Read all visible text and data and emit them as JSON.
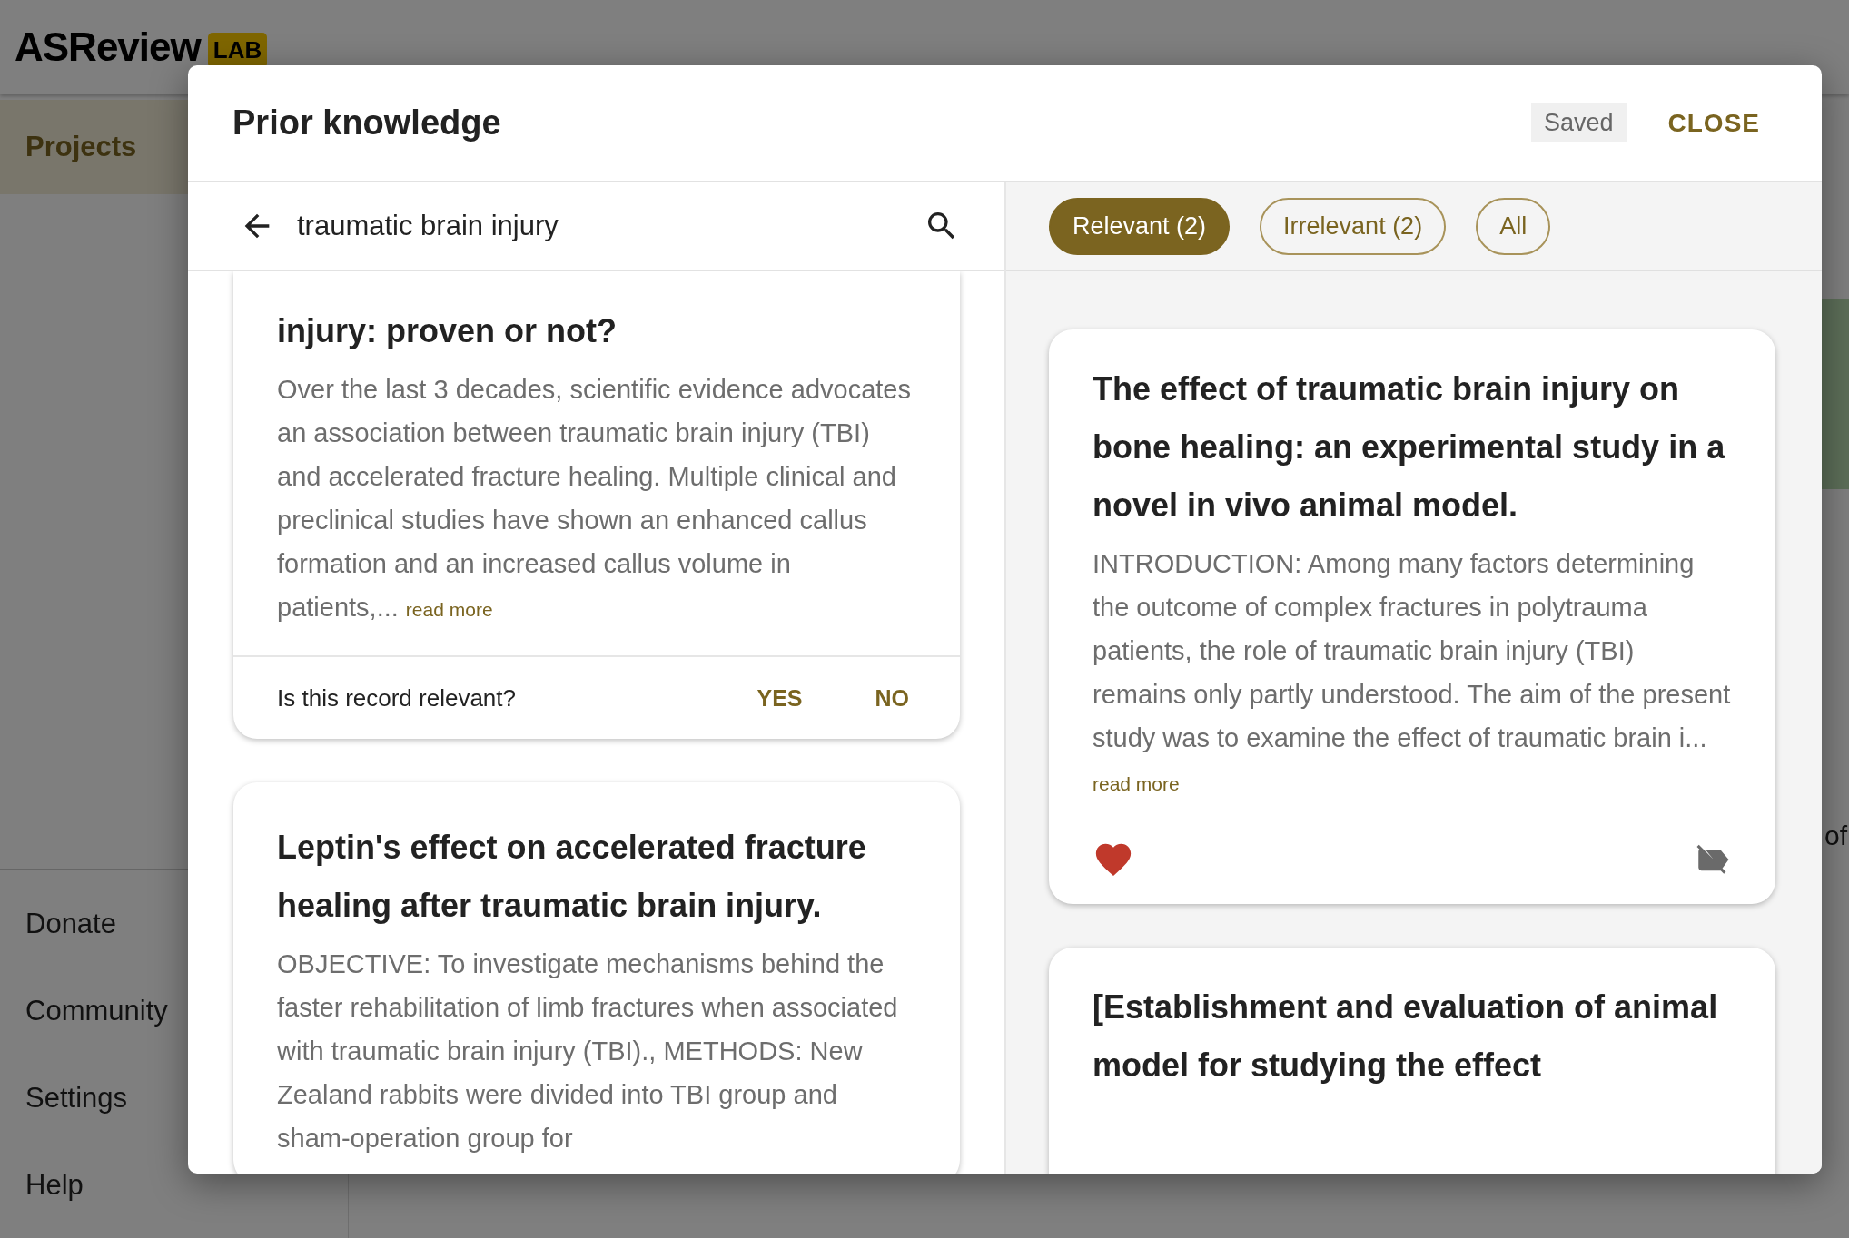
{
  "app": {
    "logo": "ASReview",
    "badge": "LAB"
  },
  "sidebar": {
    "items": [
      {
        "label": "Projects",
        "selected": true
      }
    ],
    "footer_items": [
      {
        "label": "Donate"
      },
      {
        "label": "Community"
      },
      {
        "label": "Settings"
      },
      {
        "label": "Help"
      }
    ]
  },
  "background_fragment": "of",
  "dialog": {
    "title": "Prior knowledge",
    "status": "Saved",
    "close": "CLOSE",
    "search": {
      "value": "traumatic brain injury"
    },
    "records": [
      {
        "title": "injury: proven or not?",
        "abstract": "Over the last 3 decades, scientific evidence advocates an association between traumatic brain injury (TBI) and accelerated fracture healing. Multiple clinical and preclinical studies have shown an enhanced callus formation and an increased callus volume in patients,...",
        "read_more": "read more",
        "question": "Is this record relevant?",
        "yes": "YES",
        "no": "NO"
      },
      {
        "title": "Leptin's effect on accelerated fracture healing after traumatic brain injury.",
        "abstract": "OBJECTIVE: To investigate mechanisms behind the faster rehabilitation of limb fractures when associated with traumatic brain injury (TBI)., METHODS: New Zealand rabbits were divided into TBI group and sham-operation group for"
      }
    ],
    "filters": [
      {
        "label": "Relevant (2)",
        "selected": true
      },
      {
        "label": "Irrelevant (2)",
        "selected": false
      },
      {
        "label": "All",
        "selected": false
      }
    ],
    "labeled": [
      {
        "title": "The effect of traumatic brain injury on bone healing: an experimental study in a novel in vivo animal model.",
        "abstract": "INTRODUCTION: Among many factors determining the outcome of complex fractures in polytrauma patients, the role of traumatic brain injury (TBI) remains only partly understood. The aim of the present study was to examine the effect of traumatic brain i...",
        "read_more": "read more",
        "relevant": true
      },
      {
        "title": "[Establishment and evaluation of animal model for studying the effect"
      }
    ]
  }
}
